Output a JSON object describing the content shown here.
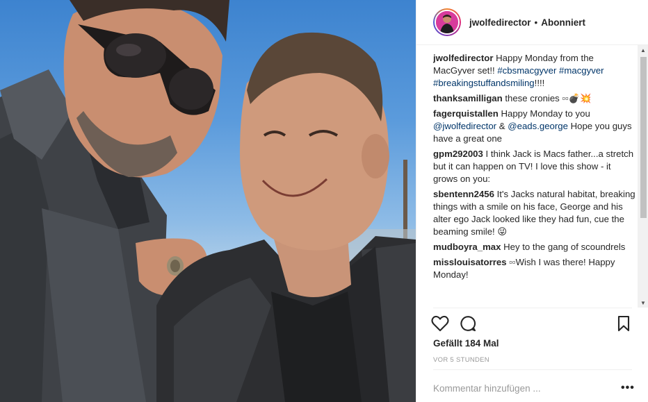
{
  "post": {
    "username": "jwolfedirector",
    "separator": "•",
    "follow_status": "Abonniert"
  },
  "comments": [
    {
      "user": "jwolfedirector",
      "text": "Happy Monday from the MacGyver set!!",
      "tags": [
        "#cbsmacgyver",
        "#macgyver",
        "#breakingstuffandsmiling"
      ],
      "tail": "!!!!"
    },
    {
      "user": "thanksamilligan",
      "text": "these cronies ▫▫💣💥"
    },
    {
      "user": "fagerquistallen",
      "text": "Happy Monday to you",
      "mention1": "@jwolfedirector",
      "amp": "&",
      "mention2": "@eads.george",
      "tail": "Hope you guys have a great one"
    },
    {
      "user": "gpm292003",
      "text": "I think Jack is Macs father...a stretch but it can happen on TV! I love this show - it grows on you:"
    },
    {
      "user": "sbentenn2456",
      "text": "It's Jacks natural habitat, breaking things with a smile on his face, George and his alter ego Jack looked like they had fun, cue the beaming smile! 😜"
    },
    {
      "user": "mudboyra_max",
      "text": "Hey to the gang of scoundrels"
    },
    {
      "user": "misslouisatorres",
      "text": "▫▫Wish I was there! Happy Monday!"
    }
  ],
  "actions": {
    "like_icon": "heart-icon",
    "comment_icon": "speech-bubble-icon",
    "save_icon": "bookmark-icon"
  },
  "likes_text": "Gefällt 184 Mal",
  "timestamp": "VOR 5 STUNDEN",
  "add_comment_placeholder": "Kommentar hinzufügen ...",
  "more_options": "•••",
  "colors": {
    "text": "#262626",
    "link": "#003569",
    "muted": "#999999",
    "border": "#efefef"
  }
}
